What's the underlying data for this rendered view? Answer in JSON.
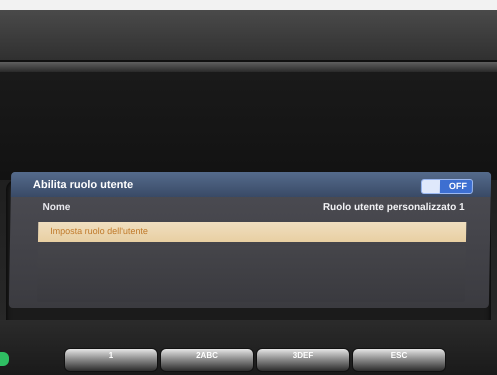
{
  "screen": {
    "title": "Abilita ruolo utente",
    "toggle": {
      "state_label": "OFF"
    },
    "row": {
      "label": "Nome",
      "value": "Ruolo utente personalizzato 1"
    },
    "menu_item": "Imposta ruolo dell'utente"
  },
  "keys": [
    {
      "label": "1"
    },
    {
      "label": "2ABC"
    },
    {
      "label": "3DEF"
    },
    {
      "label": "ESC"
    }
  ],
  "colors": {
    "title_bar": "#4a5f80",
    "toggle": "#3d6fd1",
    "menu_highlight": "#ecd5ad",
    "menu_text": "#c07a2a"
  }
}
